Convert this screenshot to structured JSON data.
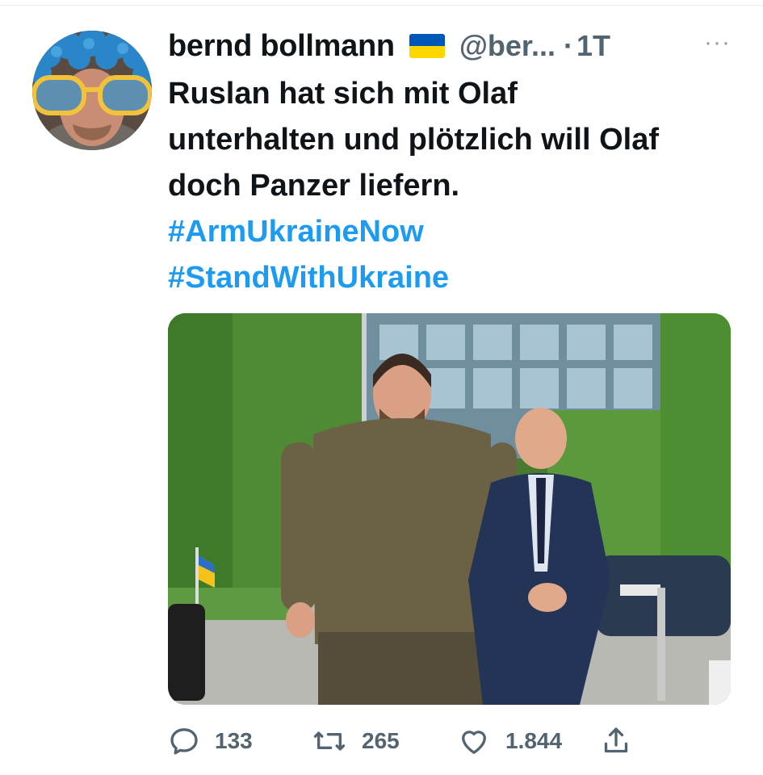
{
  "tweet": {
    "author_name": "bernd bollmann",
    "author_handle": "@ber...",
    "separator": "·",
    "time": "1T",
    "more": "···",
    "text_lines": [
      "Ruslan hat sich mit Olaf",
      "unterhalten und plötzlich will Olaf",
      "doch Panzer liefern."
    ],
    "hashtags": [
      "#ArmUkraineNow",
      "#StandWithUkraine"
    ]
  },
  "colors": {
    "hashtag": "#1d9bf0",
    "flag_blue": "#0057b7",
    "flag_yellow": "#ffd700",
    "muted": "#536471"
  },
  "icons": {
    "avatar": "avatar",
    "flag": "ukraine-flag-icon",
    "reply": "reply-icon",
    "retweet": "retweet-icon",
    "like": "heart-icon",
    "share": "share-icon",
    "more": "more-options-icon"
  },
  "actions": {
    "reply_count": "133",
    "retweet_count": "265",
    "like_count": "1.844"
  }
}
